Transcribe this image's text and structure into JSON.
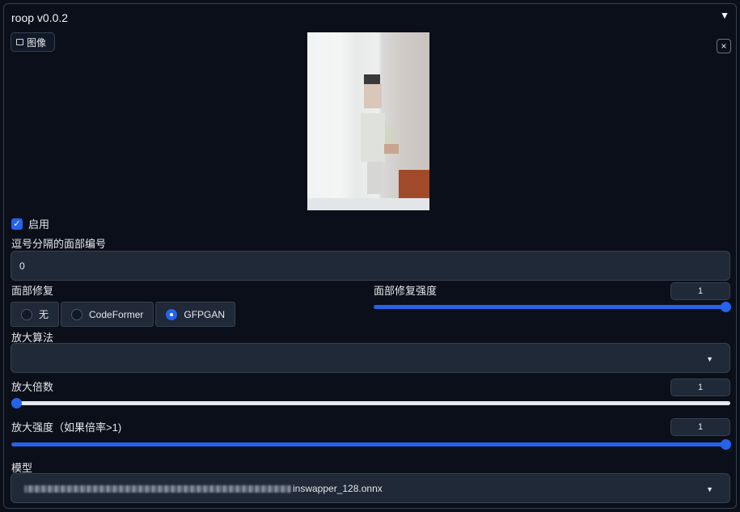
{
  "header": {
    "title": "roop v0.0.2",
    "collapse_icon": "▼"
  },
  "image_panel": {
    "tab_label": "图像",
    "tab_icon": "image-icon",
    "close_label": "×"
  },
  "enable": {
    "label": "启用",
    "checked": true
  },
  "face_index": {
    "label": "逗号分隔的面部编号",
    "value": "0"
  },
  "face_restore": {
    "label": "面部修复",
    "options": [
      "无",
      "CodeFormer",
      "GFPGAN"
    ],
    "selected": "GFPGAN"
  },
  "face_restore_strength": {
    "label": "面部修复强度",
    "value": "1",
    "level": 1.0
  },
  "upscaler": {
    "label": "放大算法",
    "value": ""
  },
  "upscale_factor": {
    "label": "放大倍数",
    "value": "1",
    "level": 0.0
  },
  "upscale_strength": {
    "label": "放大强度（如果倍率>1)",
    "value": "1",
    "level": 1.0
  },
  "model": {
    "label": "模型",
    "value_suffix": "inswapper_128.onnx"
  },
  "colors": {
    "accent": "#2563eb",
    "background": "#0b0f19",
    "input_bg": "#1f2937"
  }
}
